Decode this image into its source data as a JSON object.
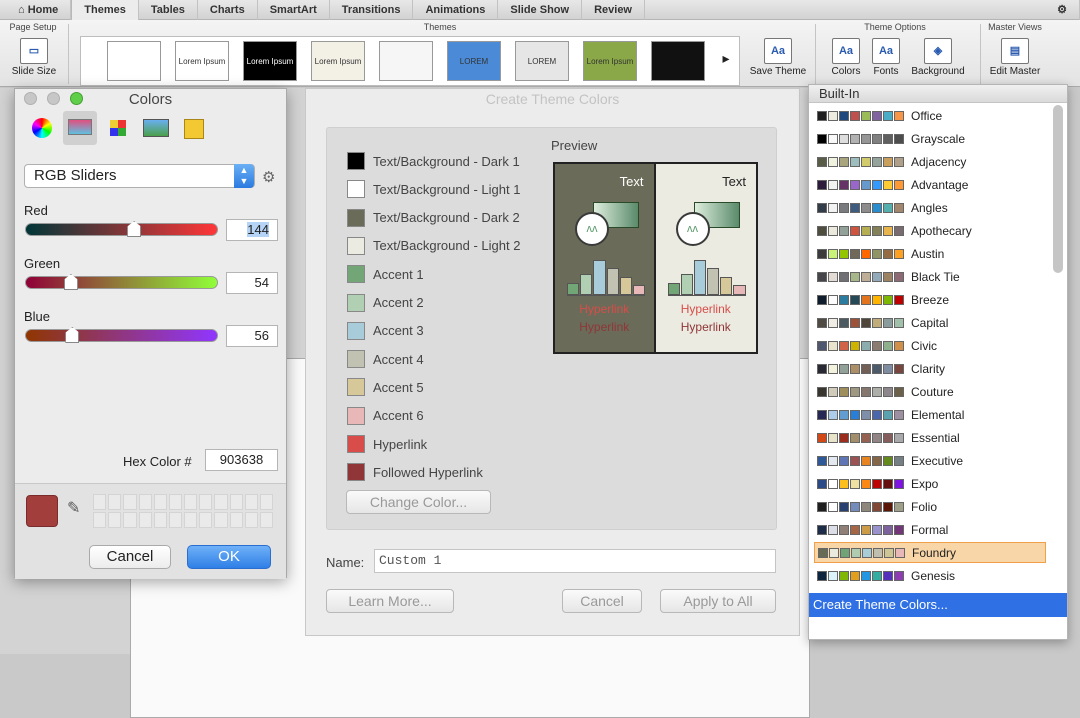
{
  "tabs": [
    "Home",
    "Themes",
    "Tables",
    "Charts",
    "SmartArt",
    "Transitions",
    "Animations",
    "Slide Show",
    "Review"
  ],
  "ribbon": {
    "page_setup": "Page Setup",
    "themes": "Themes",
    "theme_options": "Theme Options",
    "master_views": "Master Views",
    "slide_size": "Slide Size",
    "save_theme": "Save Theme",
    "colors": "Colors",
    "fonts": "Fonts",
    "background": "Background",
    "edit_master": "Edit Master",
    "thumb_texts": [
      "",
      "Lorem Ipsum",
      "Lorem Ipsum",
      "Lorem Ipsum",
      "",
      "LOREM IPSUM",
      "LOREM IPSUM",
      "Lorem Ipsum",
      ""
    ],
    "thumb_colors": [
      "#ffffff",
      "#ffffff",
      "#000000",
      "#f3f0e6",
      "#f6f6f6",
      "#4a8ad6",
      "#e6e6e6",
      "#8aa848",
      "#111111"
    ]
  },
  "create_theme": {
    "title": "Create Theme Colors",
    "preview_label": "Preview",
    "text_left": "Text",
    "text_right": "Text",
    "hyperlink": "Hyperlink",
    "followed": "Hyperlink",
    "rows": [
      {
        "label": "Text/Background - Dark 1",
        "color": "#000000"
      },
      {
        "label": "Text/Background - Light 1",
        "color": "#ffffff"
      },
      {
        "label": "Text/Background - Dark 2",
        "color": "#6b6b59"
      },
      {
        "label": "Text/Background - Light 2",
        "color": "#ebebe1"
      },
      {
        "label": "Accent 1",
        "color": "#72a676"
      },
      {
        "label": "Accent 2",
        "color": "#b1cfb2"
      },
      {
        "label": "Accent 3",
        "color": "#a8ccda"
      },
      {
        "label": "Accent 4",
        "color": "#c2c2b3"
      },
      {
        "label": "Accent 5",
        "color": "#d7c89a"
      },
      {
        "label": "Accent 6",
        "color": "#e8b7b7"
      },
      {
        "label": "Hyperlink",
        "color": "#d84d49"
      },
      {
        "label": "Followed Hyperlink",
        "color": "#903638"
      }
    ],
    "change_color": "Change Color...",
    "name_label": "Name:",
    "name_value": "Custom 1",
    "learn_more": "Learn More...",
    "cancel": "Cancel",
    "apply": "Apply to All"
  },
  "colors_panel": {
    "title": "Colors",
    "mode": "RGB Sliders",
    "red_label": "Red",
    "red_value": "144",
    "red_level": 0.565,
    "green_label": "Green",
    "green_value": "54",
    "green_level": 0.212,
    "blue_label": "Blue",
    "blue_value": "56",
    "blue_level": 0.22,
    "hex_label": "Hex Color #",
    "hex_value": "903638",
    "current_color": "#a23f3c",
    "cancel": "Cancel",
    "ok": "OK"
  },
  "themes_list": {
    "header": "Built-In",
    "create": "Create Theme Colors...",
    "items": [
      {
        "name": "Office",
        "colors": [
          "#1f1f1f",
          "#eeece1",
          "#1f497d",
          "#c0504d",
          "#9bbb59",
          "#8064a2",
          "#4bacc6",
          "#f79646"
        ]
      },
      {
        "name": "Grayscale",
        "colors": [
          "#000000",
          "#f8f8f8",
          "#dddddd",
          "#b2b2b2",
          "#969696",
          "#808080",
          "#5f5f5f",
          "#4d4d4d"
        ]
      },
      {
        "name": "Adjacency",
        "colors": [
          "#595d48",
          "#f2f2e0",
          "#a9a57c",
          "#9cbebd",
          "#d2cb6c",
          "#95a39d",
          "#c89f5d",
          "#b1a089"
        ]
      },
      {
        "name": "Advantage",
        "colors": [
          "#2d1b3b",
          "#f2f2f2",
          "#663366",
          "#9966cc",
          "#6699cc",
          "#3399ff",
          "#ffcc33",
          "#ff9933"
        ]
      },
      {
        "name": "Angles",
        "colors": [
          "#333d49",
          "#f2f2f2",
          "#797b7e",
          "#3e5c80",
          "#8c8c8c",
          "#2a8dcd",
          "#55b0ad",
          "#a3876d"
        ]
      },
      {
        "name": "Apothecary",
        "colors": [
          "#4e4d3e",
          "#eceadc",
          "#93a299",
          "#cf543f",
          "#b5ae53",
          "#848058",
          "#e8b54d",
          "#786c71"
        ]
      },
      {
        "name": "Austin",
        "colors": [
          "#3b3b3b",
          "#caf278",
          "#94c600",
          "#71685a",
          "#ff6700",
          "#909465",
          "#956b43",
          "#fea022"
        ]
      },
      {
        "name": "Black Tie",
        "colors": [
          "#46464a",
          "#e3dcd4",
          "#6f6f74",
          "#a7b789",
          "#beae98",
          "#92a9b9",
          "#9c8265",
          "#8d6974"
        ]
      },
      {
        "name": "Breeze",
        "colors": [
          "#0f1d2d",
          "#fdfdfd",
          "#2c7c9f",
          "#244a58",
          "#e2751d",
          "#ffb400",
          "#7eb606",
          "#c00000"
        ]
      },
      {
        "name": "Capital",
        "colors": [
          "#4f4a42",
          "#f0ede4",
          "#4b5a60",
          "#9c5238",
          "#504539",
          "#c1ad79",
          "#8a9d9c",
          "#a2c1aa"
        ]
      },
      {
        "name": "Civic",
        "colors": [
          "#4f5770",
          "#e9e3cd",
          "#d16349",
          "#ccb400",
          "#8cadae",
          "#8c7b70",
          "#8fb08c",
          "#d19049"
        ]
      },
      {
        "name": "Clarity",
        "colors": [
          "#292934",
          "#f3f2dc",
          "#93a299",
          "#ad8f67",
          "#726056",
          "#4c5a6a",
          "#808da0",
          "#79463d"
        ]
      },
      {
        "name": "Couture",
        "colors": [
          "#37352e",
          "#d0ccb9",
          "#9e8e5c",
          "#a09781",
          "#85776d",
          "#aeafa9",
          "#8d878b",
          "#6b6149"
        ]
      },
      {
        "name": "Elemental",
        "colors": [
          "#242852",
          "#acccea",
          "#629dd1",
          "#297fd5",
          "#7f8fa9",
          "#4a66ac",
          "#5aa2ae",
          "#9d90a0"
        ]
      },
      {
        "name": "Essential",
        "colors": [
          "#d34817",
          "#e8e4c9",
          "#9b2d1f",
          "#a28e6a",
          "#956251",
          "#918485",
          "#855d5d",
          "#a9a8aa"
        ]
      },
      {
        "name": "Executive",
        "colors": [
          "#2f5897",
          "#e4e9ef",
          "#6076b4",
          "#9c5252",
          "#e68422",
          "#846648",
          "#63891f",
          "#758085"
        ]
      },
      {
        "name": "Expo",
        "colors": [
          "#2a4b85",
          "#ffffff",
          "#fbc01e",
          "#efe1a2",
          "#fa8716",
          "#be0204",
          "#640f10",
          "#7e13e3"
        ]
      },
      {
        "name": "Folio",
        "colors": [
          "#1f1f1f",
          "#ffffff",
          "#294171",
          "#748cbc",
          "#8e887c",
          "#834736",
          "#5a1705",
          "#a0a088"
        ]
      },
      {
        "name": "Formal",
        "colors": [
          "#1e2d47",
          "#dcdfe8",
          "#907f76",
          "#a46645",
          "#cd9c47",
          "#9a92cd",
          "#7d639b",
          "#733678"
        ]
      },
      {
        "name": "Foundry",
        "colors": [
          "#676a55",
          "#eaebde",
          "#72a376",
          "#b0ccb0",
          "#a8cdd7",
          "#c0beaf",
          "#cec597",
          "#e8b7b7"
        ]
      },
      {
        "name": "Genesis",
        "colors": [
          "#0f243e",
          "#ddf3fb",
          "#80b606",
          "#e29f1d",
          "#2397e2",
          "#35aca2",
          "#5430bb",
          "#8d3cb1"
        ]
      }
    ]
  }
}
